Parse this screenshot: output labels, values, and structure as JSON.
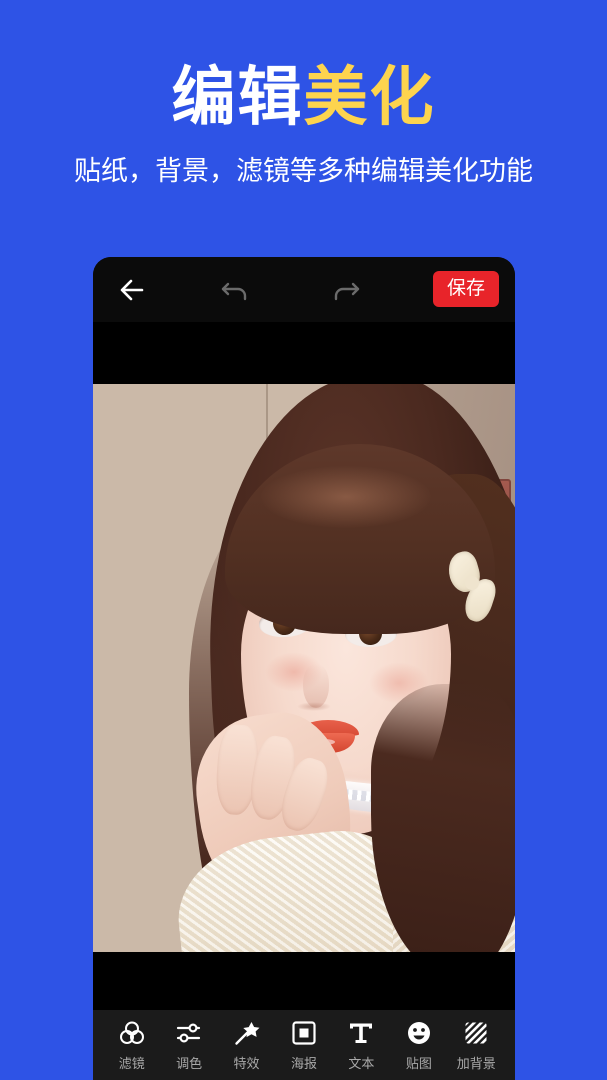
{
  "promo": {
    "title_white": "编辑",
    "title_yellow": "美化",
    "subtitle": "贴纸，背景，滤镜等多种编辑美化功能",
    "bg_color": "#2E53E6",
    "white_color": "#FFFFFF",
    "yellow_color": "#FDD44E"
  },
  "app": {
    "appbar": {
      "back_icon": "arrow-left-icon",
      "undo_icon": "undo-arrow-icon",
      "redo_icon": "redo-arrow-icon",
      "save_label": "保存",
      "save_color": "#E8242A",
      "bar_bg": "#0B0B0B",
      "icon_active_color": "#FFFFFF",
      "icon_disabled_color": "#6B6B6B"
    },
    "canvas": {
      "photo_description": "年轻女性肖像照片",
      "backdrop_color": "#000000"
    },
    "toolbar": {
      "bg": "#1B1B1B",
      "label_color": "#A9A9A9",
      "items": [
        {
          "label": "滤镜",
          "icon": "three-circles-filter-icon"
        },
        {
          "label": "调色",
          "icon": "sliders-adjust-icon"
        },
        {
          "label": "特效",
          "icon": "magic-wand-star-icon"
        },
        {
          "label": "海报",
          "icon": "nested-square-poster-icon"
        },
        {
          "label": "文本",
          "icon": "text-t-icon"
        },
        {
          "label": "贴图",
          "icon": "smiley-sticker-icon"
        },
        {
          "label": "加背景",
          "icon": "diagonal-stripes-background-icon"
        }
      ]
    }
  }
}
